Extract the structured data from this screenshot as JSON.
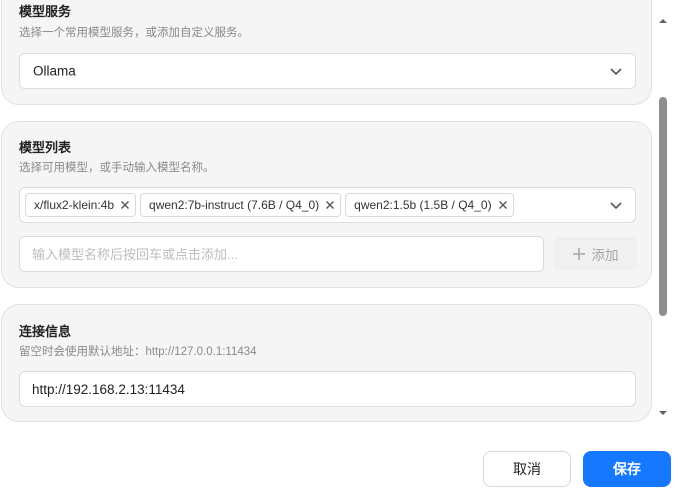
{
  "model_service": {
    "title": "模型服务",
    "subtitle": "选择一个常用模型服务，或添加自定义服务。",
    "selected": "Ollama"
  },
  "model_list": {
    "title": "模型列表",
    "subtitle": "选择可用模型，或手动输入模型名称。",
    "tags": [
      "x/flux2-klein:4b",
      "qwen2:7b-instruct (7.6B / Q4_0)",
      "qwen2:1.5b (1.5B / Q4_0)"
    ],
    "input_placeholder": "输入模型名称后按回车或点击添加...",
    "add_label": "添加"
  },
  "connection": {
    "title": "连接信息",
    "subtitle": "留空时会使用默认地址：http://127.0.0.1:11434",
    "address_value": "http://192.168.2.13:11434"
  },
  "footer": {
    "cancel_label": "取消",
    "save_label": "保存"
  },
  "colors": {
    "primary": "#1677ff",
    "card_bg": "#f5f5f5"
  }
}
